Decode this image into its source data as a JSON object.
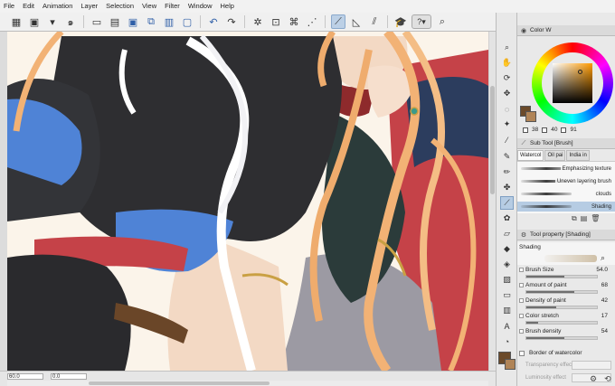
{
  "menu": [
    "File",
    "Edit",
    "Animation",
    "Layer",
    "Selection",
    "View",
    "Filter",
    "Window",
    "Help"
  ],
  "toolbar": {
    "icons": [
      "grid-icon",
      "display-icon",
      "dropdown-icon",
      "spiral-icon",
      "new-icon",
      "open-icon",
      "save-icon",
      "export-icon",
      "print-icon",
      "select-icon",
      "undo-icon",
      "redo-icon",
      "loading-icon",
      "crop-icon",
      "transform-icon",
      "snap-ruler-icon",
      "snap-grid-icon",
      "learn-icon",
      "help-icon",
      "search-icon"
    ]
  },
  "canvas": {
    "colors": {
      "background": "#fbf4ea",
      "hair_orange": "#f2b275",
      "jacket_dark": "#2e2e31",
      "blue_fabric": "#4f83d6",
      "red_band": "#c54248",
      "skin": "#f3d9c4",
      "grey_cloth": "#9c9aa3"
    }
  },
  "status": {
    "zoom": "60.0",
    "angle": "0.0"
  },
  "tools": [
    "zoom-icon",
    "hand-icon",
    "rotate-icon",
    "move-icon",
    "lasso-icon",
    "wand-icon",
    "eyedropper-icon",
    "pen-icon",
    "pencil-icon",
    "airbrush-icon",
    "brush-icon",
    "decoration-icon",
    "eraser-icon",
    "blend-icon",
    "fill-icon",
    "gradient-icon",
    "figure-icon",
    "frame-icon",
    "text-icon",
    "balloon-icon",
    "line-icon",
    "ruler-icon",
    "3d-icon",
    "vector-icon"
  ],
  "colorPanel": {
    "tab": "Color W",
    "main_color": "#6b4a2a",
    "sub_color": "#b08457",
    "hsv": {
      "h": "38",
      "s": "40",
      "v": "91"
    }
  },
  "subTool": {
    "header": "Sub Tool [Brush]",
    "tabs": [
      "Watercol",
      "Oil pai",
      "India in"
    ],
    "brushes": [
      "Emphasizing texture",
      "Uneven layering brush",
      "clouds",
      "Shading"
    ]
  },
  "toolProperty": {
    "header": "Tool property [Shading]",
    "name": "Shading",
    "props": [
      {
        "label": "Brush Size",
        "value": "54.0",
        "fill": 0.54
      },
      {
        "label": "Amount of paint",
        "value": "68",
        "fill": 0.68
      },
      {
        "label": "Density of paint",
        "value": "42",
        "fill": 0.42
      },
      {
        "label": "Color stretch",
        "value": "17",
        "fill": 0.17
      },
      {
        "label": "Brush density",
        "value": "54",
        "fill": 0.54
      }
    ],
    "border_label": "Border of watercolor",
    "dim_rows": [
      "Transparency effect",
      "Luminosity effect"
    ]
  }
}
